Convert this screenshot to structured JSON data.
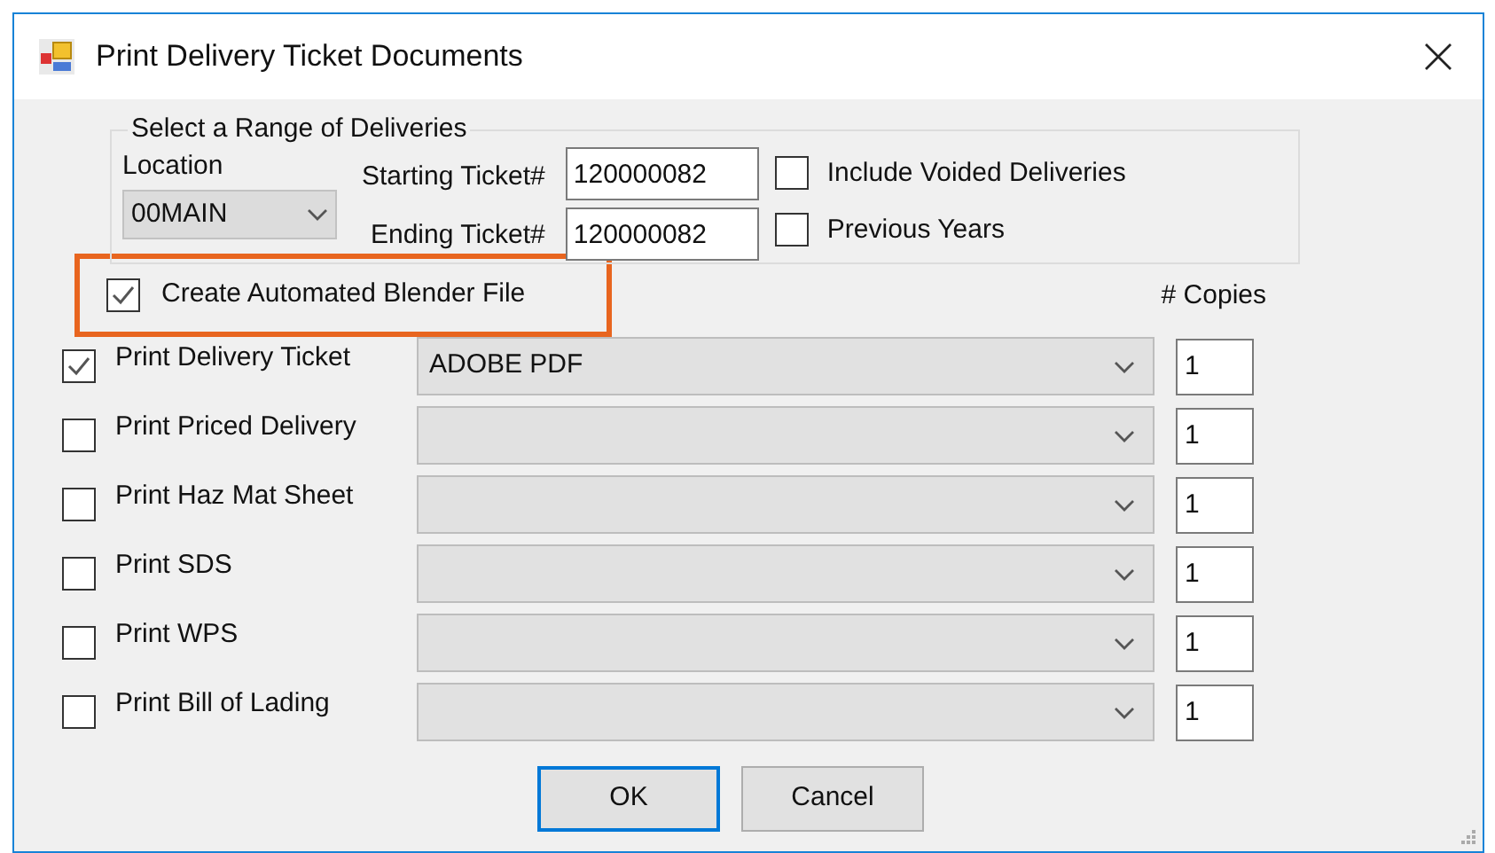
{
  "window": {
    "title": "Print Delivery Ticket Documents"
  },
  "range": {
    "legend": "Select a Range of Deliveries",
    "location_label": "Location",
    "location_value": "00MAIN",
    "starting_label": "Starting Ticket#",
    "starting_value": "120000082",
    "ending_label": "Ending Ticket#",
    "ending_value": "120000082",
    "options": [
      {
        "label": "Include Voided Deliveries",
        "checked": false
      },
      {
        "label": "Previous Years",
        "checked": false
      }
    ]
  },
  "blender": {
    "label": "Create Automated Blender File",
    "checked": true,
    "highlighted": true
  },
  "copies_header": "# Copies",
  "documents": [
    {
      "label": "Print Delivery Ticket",
      "checked": true,
      "printer": "ADOBE PDF",
      "copies": "1"
    },
    {
      "label": "Print Priced Delivery",
      "checked": false,
      "copies": "1"
    },
    {
      "label": "Print Haz Mat Sheet",
      "checked": false,
      "copies": "1"
    },
    {
      "label": "Print SDS",
      "checked": false,
      "copies": "1"
    },
    {
      "label": "Print WPS",
      "checked": false,
      "copies": "1"
    },
    {
      "label": "Print Bill of Lading",
      "checked": false,
      "copies": "1"
    }
  ],
  "buttons": [
    {
      "label": "OK",
      "default": true
    },
    {
      "label": "Cancel",
      "default": false
    }
  ]
}
